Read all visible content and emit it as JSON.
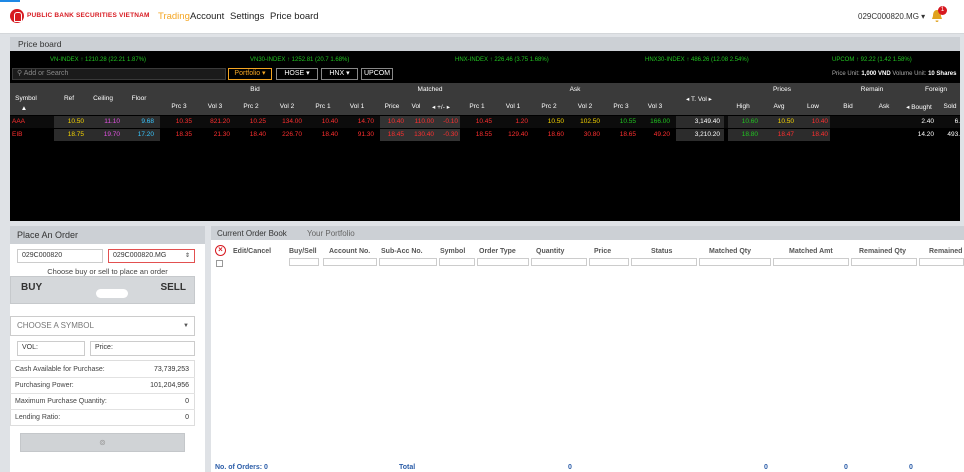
{
  "app": {
    "brand": "PUBLIC BANK SECURITIES VIETNAM",
    "nav": [
      "Trading",
      "Account",
      "Settings",
      "Price board"
    ],
    "account_menu": "029C000820.MG",
    "notification_count": "1"
  },
  "price_board": {
    "title": "Price board",
    "indices": [
      {
        "text": "VN-INDEX ↑ 1210.28 (22.21 1.87%)",
        "color": "#21c321"
      },
      {
        "text": "VN30-INDEX ↑ 1252.81 (20.7 1.68%)",
        "color": "#21c321"
      },
      {
        "text": "HNX-INDEX ↑ 226.46 (3.75 1.68%)",
        "color": "#21c321"
      },
      {
        "text": "HNX30-INDEX ↑ 486.26 (12.08 2.54%)",
        "color": "#21c321"
      },
      {
        "text": "UPCOM ↑ 92.22 (1.42 1.58%)",
        "color": "#21c321"
      }
    ],
    "search_placeholder": "Add or Search",
    "filters": {
      "portfolio": "Portfolio ▾",
      "hose": "HOSE ▾",
      "hnx": "HNX ▾",
      "upcom": "UPCOM"
    },
    "unit_info": {
      "price_label": "Price Unit:",
      "price_value": "1,000 VND",
      "volume_label": "Volume Unit:",
      "volume_value": "10 Shares"
    },
    "groups": {
      "bid": "Bid",
      "matched": "Matched",
      "ask": "Ask",
      "prices": "Prices",
      "remain": "Remain",
      "foreign": "Foreign"
    },
    "columns": {
      "symbol": "Symbol",
      "ref": "Ref",
      "ceiling": "Ceiling",
      "floor": "Floor",
      "prc3": "Prc 3",
      "vol3": "Vol 3",
      "prc2": "Prc 2",
      "vol2": "Vol 2",
      "prc1": "Prc 1",
      "vol1": "Vol 1",
      "price": "Price",
      "vol": "Vol",
      "change": "◂ +/- ▸",
      "aprc1": "Prc 1",
      "avol1": "Vol 1",
      "aprc2": "Prc 2",
      "avol2": "Vol 2",
      "aprc3": "Prc 3",
      "avol3": "Vol 3",
      "tvol": "◂ T. Vol ▸",
      "high": "High",
      "avg": "Avg",
      "low": "Low",
      "rbid": "Bid",
      "rask": "Ask",
      "bought": "◂ Bought",
      "sold": "Sold"
    },
    "rows": [
      {
        "symbol": "AAA",
        "ref": "10.50",
        "ceiling": "11.10",
        "floor": "9.68",
        "bid": [
          "10.35",
          "821.20",
          "10.25",
          "134.00",
          "10.40",
          "14.70"
        ],
        "matched": [
          "10.40",
          "110.00",
          "-0.10"
        ],
        "ask": [
          "10.45",
          "1.20",
          "10.50",
          "102.50",
          "10.55",
          "166.00"
        ],
        "tvol": "3,149.40",
        "high": "10.60",
        "avg": "10.50",
        "low": "10.40",
        "bought": "2.40",
        "sold": "6."
      },
      {
        "symbol": "EIB",
        "ref": "18.75",
        "ceiling": "19.70",
        "floor": "17.20",
        "bid": [
          "18.35",
          "21.30",
          "18.40",
          "226.70",
          "18.40",
          "91.30"
        ],
        "matched": [
          "18.45",
          "130.40",
          "-0.30"
        ],
        "ask": [
          "18.55",
          "129.40",
          "18.60",
          "30.80",
          "18.65",
          "49.20"
        ],
        "tvol": "3,210.20",
        "high": "18.80",
        "avg": "18.47",
        "low": "18.40",
        "bought": "14.20",
        "sold": "493."
      }
    ]
  },
  "place_order": {
    "title": "Place An Order",
    "account": "029C000820",
    "sub_account": "029C000820.MG",
    "hint": "Choose buy or sell to place an order",
    "buy": "BUY",
    "sell": "SELL",
    "symbol_placeholder": "CHOOSE A SYMBOL",
    "vol_placeholder": "VOL:",
    "price_placeholder": "Price:",
    "info": [
      {
        "label": "Cash Available for Purchase:",
        "value": "73,739,253"
      },
      {
        "label": "Purchasing Power:",
        "value": "101,204,956"
      },
      {
        "label": "Maximum Purchase Quantity:",
        "value": "0"
      },
      {
        "label": "Lending Ratio:",
        "value": "0"
      }
    ]
  },
  "order_book": {
    "tabs": [
      "Current Order Book",
      "Your Portfolio"
    ],
    "columns": [
      "Edit/Cancel",
      "Buy/Sell",
      "Account No.",
      "Sub-Acc No.",
      "Symbol",
      "Order Type",
      "Quantity",
      "Price",
      "Status",
      "Matched Qty",
      "Matched Amt",
      "Remained Qty",
      "Remained"
    ],
    "footer": {
      "orders": "No. of Orders: 0",
      "total": "Total",
      "v1": "0",
      "v2": "0",
      "v3": "0",
      "v4": "0"
    }
  }
}
